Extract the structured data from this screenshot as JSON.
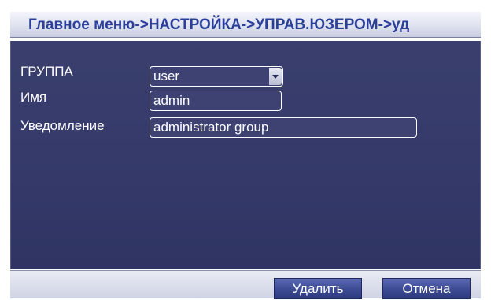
{
  "window": {
    "breadcrumb": "Главное меню->НАСТРОЙКА->УПРАВ.ЮЗЕРОМ->уд"
  },
  "form": {
    "group": {
      "label": "ГРУППА",
      "value": "user"
    },
    "name": {
      "label": "Имя",
      "value": "admin"
    },
    "notice": {
      "label": "Уведомление",
      "value": "administrator group"
    }
  },
  "buttons": {
    "delete": "Удалить",
    "cancel": "Отмена"
  },
  "icons": {
    "dropdown": "chevron-down-icon"
  },
  "colors": {
    "title_text": "#2a3f9a",
    "panel_bg": "#3a3f6d",
    "button_bg": "#3c4a94"
  }
}
